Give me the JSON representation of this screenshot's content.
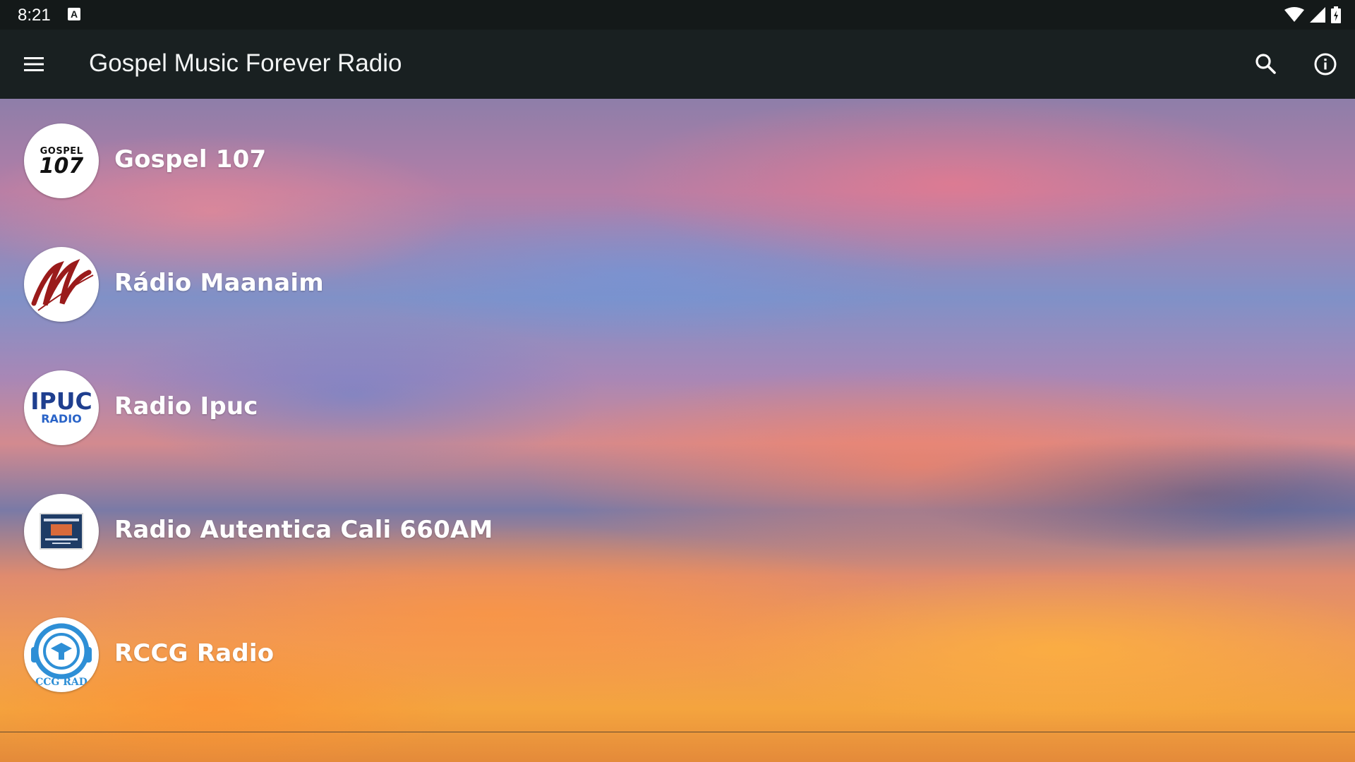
{
  "status_bar": {
    "time": "8:21",
    "notification_icon": "a-icon",
    "icons": [
      "wifi-icon",
      "signal-icon",
      "battery-charging-icon"
    ]
  },
  "app_bar": {
    "title": "Gospel Music Forever Radio",
    "menu_icon": "menu-icon",
    "search_icon": "search-icon",
    "info_icon": "info-icon"
  },
  "stations": [
    {
      "name": "Gospel 107",
      "logo": "gospel-107-logo",
      "logo_text_1": "GOSPEL",
      "logo_text_2": "107"
    },
    {
      "name": "Rádio Maanaim",
      "logo": "radio-maanaim-logo",
      "logo_text_1": "M"
    },
    {
      "name": "Radio Ipuc",
      "logo": "radio-ipuc-logo",
      "logo_text_1": "IPUC",
      "logo_text_2": "RADIO"
    },
    {
      "name": "Radio Autentica Cali 660AM",
      "logo": "radio-autentica-logo"
    },
    {
      "name": "RCCG Radio",
      "logo": "rccg-radio-logo",
      "logo_text_1": "CCG RAD"
    }
  ],
  "colors": {
    "status_bar": "#141919",
    "app_bar": "#192021",
    "text": "#ffffff"
  }
}
